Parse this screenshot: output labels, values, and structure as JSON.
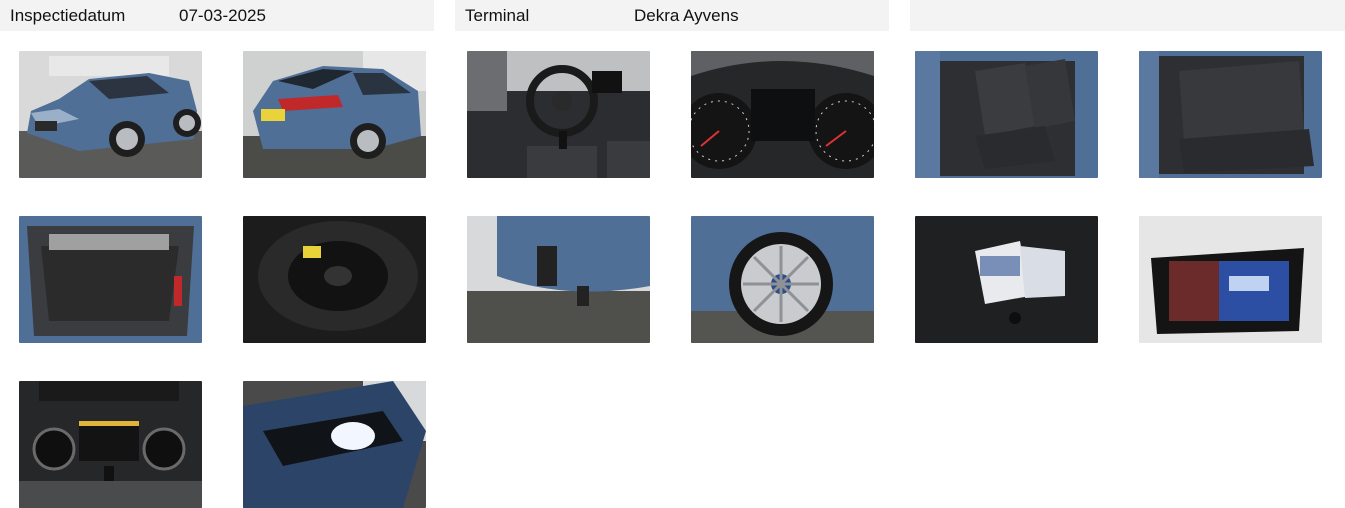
{
  "header": {
    "inspection_date_label": "Inspectiedatum",
    "inspection_date_value": "07-03-2025",
    "terminal_label": "Terminal",
    "terminal_value": "Dekra Ayvens"
  },
  "photos": [
    {
      "subject": "front-three-quarter exterior"
    },
    {
      "subject": "rear-three-quarter exterior"
    },
    {
      "subject": "dashboard and steering wheel"
    },
    {
      "subject": "instrument cluster"
    },
    {
      "subject": "front seats"
    },
    {
      "subject": "rear seats"
    },
    {
      "subject": "open trunk"
    },
    {
      "subject": "spare wheel"
    },
    {
      "subject": "tow bar"
    },
    {
      "subject": "alloy wheel"
    },
    {
      "subject": "manuals and key"
    },
    {
      "subject": "infotainment screen"
    },
    {
      "subject": "climate controls"
    },
    {
      "subject": "headlight"
    }
  ],
  "colors": {
    "header_bg": "#f3f3f3",
    "car_blue": "#4f6f97"
  }
}
